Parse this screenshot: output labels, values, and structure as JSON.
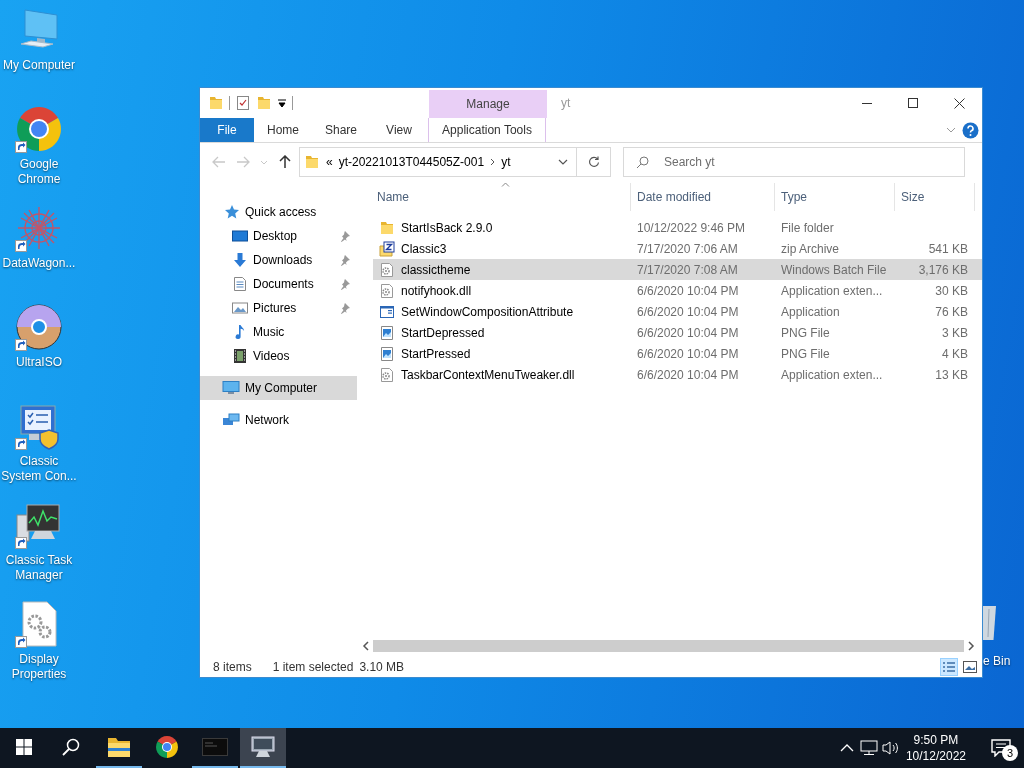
{
  "desktop_icons": [
    {
      "label": "My Computer",
      "kind": "computer",
      "shortcut": false
    },
    {
      "label": "Google Chrome",
      "kind": "chrome",
      "shortcut": true
    },
    {
      "label": "DataWagon...",
      "kind": "snowflake",
      "shortcut": true
    },
    {
      "label": "UltraISO",
      "kind": "disc",
      "shortcut": true
    },
    {
      "label": "Classic System Con...",
      "kind": "syscon",
      "shortcut": true
    },
    {
      "label": "Classic Task Manager",
      "kind": "taskmgr",
      "shortcut": true
    },
    {
      "label": "Display Properties",
      "kind": "display",
      "shortcut": true
    }
  ],
  "partial_desktop_icon": {
    "label": "e Bin",
    "kind": "recycle_bin"
  },
  "explorer": {
    "title": "yt",
    "context_tab_group": "Manage",
    "ribbon_tabs": [
      {
        "label": "File",
        "kind": "file"
      },
      {
        "label": "Home",
        "kind": "tab"
      },
      {
        "label": "Share",
        "kind": "tab"
      },
      {
        "label": "View",
        "kind": "tab"
      },
      {
        "label": "Application Tools",
        "kind": "context"
      }
    ],
    "nav_buttons": [
      {
        "kind": "back",
        "disabled": true
      },
      {
        "kind": "forward",
        "disabled": true
      },
      {
        "kind": "recent",
        "disabled": true
      },
      {
        "kind": "up",
        "disabled": false
      }
    ],
    "address": {
      "overflow": "«",
      "segments": [
        "yt-20221013T044505Z-001",
        "yt"
      ]
    },
    "search": {
      "placeholder": "Search yt"
    },
    "nav_pane": [
      {
        "label": "Quick access",
        "kind": "star",
        "selected": false,
        "children": [
          {
            "label": "Desktop",
            "kind": "desktop",
            "pinned": true,
            "selected": false
          },
          {
            "label": "Downloads",
            "kind": "download",
            "pinned": true,
            "selected": false
          },
          {
            "label": "Documents",
            "kind": "document",
            "pinned": true,
            "selected": false
          },
          {
            "label": "Pictures",
            "kind": "picture",
            "pinned": true,
            "selected": false
          },
          {
            "label": "Music",
            "kind": "music",
            "pinned": false,
            "selected": false
          },
          {
            "label": "Videos",
            "kind": "video",
            "pinned": false,
            "selected": false
          }
        ]
      },
      {
        "label": "My Computer",
        "kind": "computer",
        "selected": true
      },
      {
        "label": "Network",
        "kind": "network",
        "selected": false
      }
    ],
    "columns": [
      {
        "label": "Name",
        "sorted": true
      },
      {
        "label": "Date modified",
        "sorted": false
      },
      {
        "label": "Type",
        "sorted": false
      },
      {
        "label": "Size",
        "sorted": false
      }
    ],
    "files": [
      {
        "name": "StartIsBack 2.9.0",
        "kind": "folder",
        "date": "10/12/2022 9:46 PM",
        "type": "File folder",
        "selected": false
      },
      {
        "name": "Classic3",
        "kind": "zip",
        "date": "7/17/2020 7:06 AM",
        "type": "zip Archive",
        "size": "541 KB",
        "selected": false
      },
      {
        "name": "classictheme",
        "kind": "batch",
        "date": "7/17/2020 7:08 AM",
        "type": "Windows Batch File",
        "size": "3,176 KB",
        "selected": true
      },
      {
        "name": "notifyhook.dll",
        "kind": "dll",
        "date": "6/6/2020 10:04 PM",
        "type": "Application exten...",
        "size": "30 KB",
        "selected": false
      },
      {
        "name": "SetWindowCompositionAttribute",
        "kind": "app",
        "date": "6/6/2020 10:04 PM",
        "type": "Application",
        "size": "76 KB",
        "selected": false
      },
      {
        "name": "StartDepressed",
        "kind": "png",
        "date": "6/6/2020 10:04 PM",
        "type": "PNG File",
        "size": "3 KB",
        "selected": false
      },
      {
        "name": "StartPressed",
        "kind": "png",
        "date": "6/6/2020 10:04 PM",
        "type": "PNG File",
        "size": "4 KB",
        "selected": false
      },
      {
        "name": "TaskbarContextMenuTweaker.dll",
        "kind": "dll",
        "date": "6/6/2020 10:04 PM",
        "type": "Application exten...",
        "size": "13 KB",
        "selected": false
      }
    ],
    "status": {
      "item_count": "8 items",
      "selection": "1 item selected",
      "selection_size": "3.10 MB"
    },
    "views": [
      {
        "kind": "details",
        "selected": true
      },
      {
        "kind": "thumbnails",
        "selected": false
      }
    ]
  },
  "taskbar": {
    "apps": [
      {
        "kind": "explorer",
        "running": true,
        "active": false
      },
      {
        "kind": "chrome",
        "running": false,
        "active": false
      },
      {
        "kind": "console",
        "running": true,
        "active": false
      },
      {
        "kind": "monitor",
        "running": true,
        "active": true
      }
    ],
    "clock": {
      "time": "9:50 PM",
      "date": "10/12/2022"
    },
    "notifications": "3"
  }
}
